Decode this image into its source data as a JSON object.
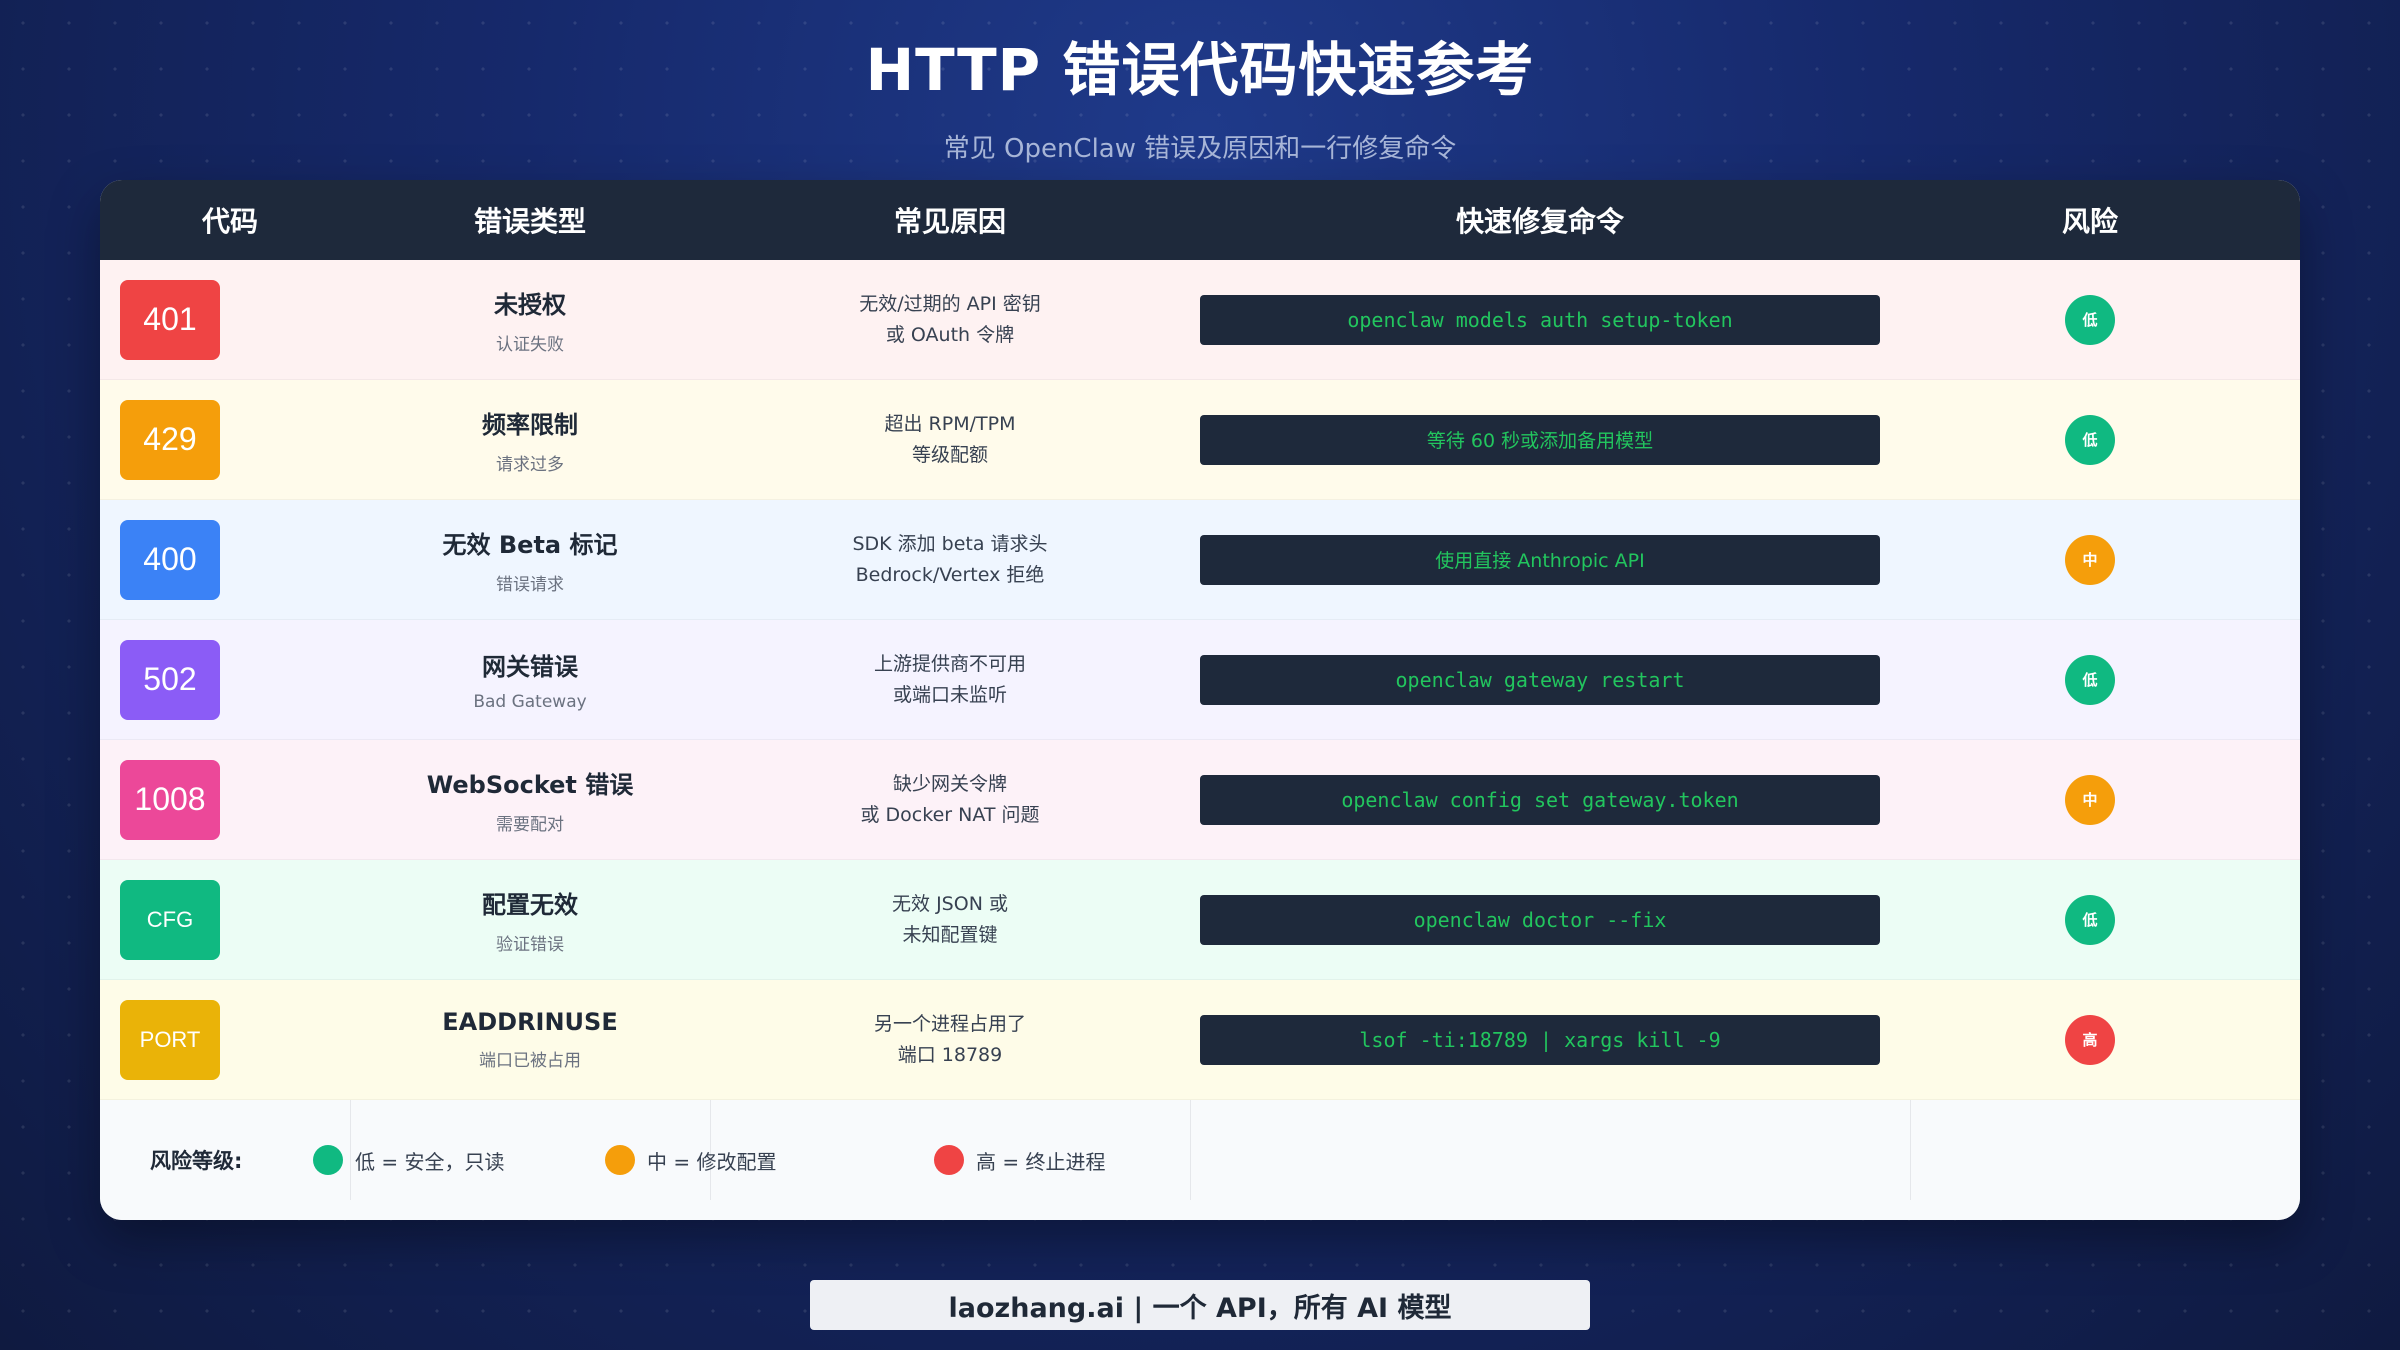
{
  "header": {
    "title": "HTTP 错误代码快速参考",
    "subtitle": "常见 OpenClaw 错误及原因和一行修复命令"
  },
  "table": {
    "columns": [
      "代码",
      "错误类型",
      "常见原因",
      "快速修复命令",
      "风险"
    ],
    "rows": [
      {
        "code": "401",
        "code_color": "#ef4444",
        "row_bg": "#fef2f2",
        "type": "未授权",
        "type_sub": "认证失败",
        "cause_1": "无效/过期的 API 密钥",
        "cause_2": "或 OAuth 令牌",
        "fix": "openclaw models auth setup-token",
        "risk": "低",
        "risk_color": "#10b981"
      },
      {
        "code": "429",
        "code_color": "#f59e0b",
        "row_bg": "#fffbeb",
        "type": "频率限制",
        "type_sub": "请求过多",
        "cause_1": "超出 RPM/TPM",
        "cause_2": "等级配额",
        "fix": "等待 60 秒或添加备用模型",
        "risk": "低",
        "risk_color": "#10b981"
      },
      {
        "code": "400",
        "code_color": "#3b82f6",
        "row_bg": "#eff6ff",
        "type": "无效 Beta 标记",
        "type_sub": "错误请求",
        "cause_1": "SDK 添加 beta 请求头",
        "cause_2": "Bedrock/Vertex 拒绝",
        "fix": "使用直接 Anthropic API",
        "risk": "中",
        "risk_color": "#f59e0b"
      },
      {
        "code": "502",
        "code_color": "#8b5cf6",
        "row_bg": "#f5f3ff",
        "type": "网关错误",
        "type_sub": "Bad Gateway",
        "cause_1": "上游提供商不可用",
        "cause_2": "或端口未监听",
        "fix": "openclaw gateway restart",
        "risk": "低",
        "risk_color": "#10b981"
      },
      {
        "code": "1008",
        "code_color": "#ec4899",
        "row_bg": "#fdf2f8",
        "type": "WebSocket 错误",
        "type_sub": "需要配对",
        "cause_1": "缺少网关令牌",
        "cause_2": "或 Docker NAT 问题",
        "fix": "openclaw config set gateway.token",
        "risk": "中",
        "risk_color": "#f59e0b"
      },
      {
        "code": "CFG",
        "code_color": "#10b981",
        "row_bg": "#ecfdf5",
        "type": "配置无效",
        "type_sub": "验证错误",
        "cause_1": "无效 JSON 或",
        "cause_2": "未知配置键",
        "fix": "openclaw doctor --fix",
        "risk": "低",
        "risk_color": "#10b981"
      },
      {
        "code": "PORT",
        "code_color": "#eab308",
        "row_bg": "#fefce8",
        "type": "EADDRINUSE",
        "type_sub": "端口已被占用",
        "cause_1": "另一个进程占用了",
        "cause_2": "端口 18789",
        "fix": "lsof -ti:18789 | xargs kill -9",
        "risk": "高",
        "risk_color": "#ef4444"
      }
    ]
  },
  "legend": {
    "title": "风险等级:",
    "items": [
      {
        "label": "低 = 安全，只读",
        "color": "#10b981"
      },
      {
        "label": "中 = 修改配置",
        "color": "#f59e0b"
      },
      {
        "label": "高 = 终止进程",
        "color": "#ef4444"
      }
    ]
  },
  "footer": {
    "text": "laozhang.ai | 一个 API，所有 AI 模型"
  }
}
